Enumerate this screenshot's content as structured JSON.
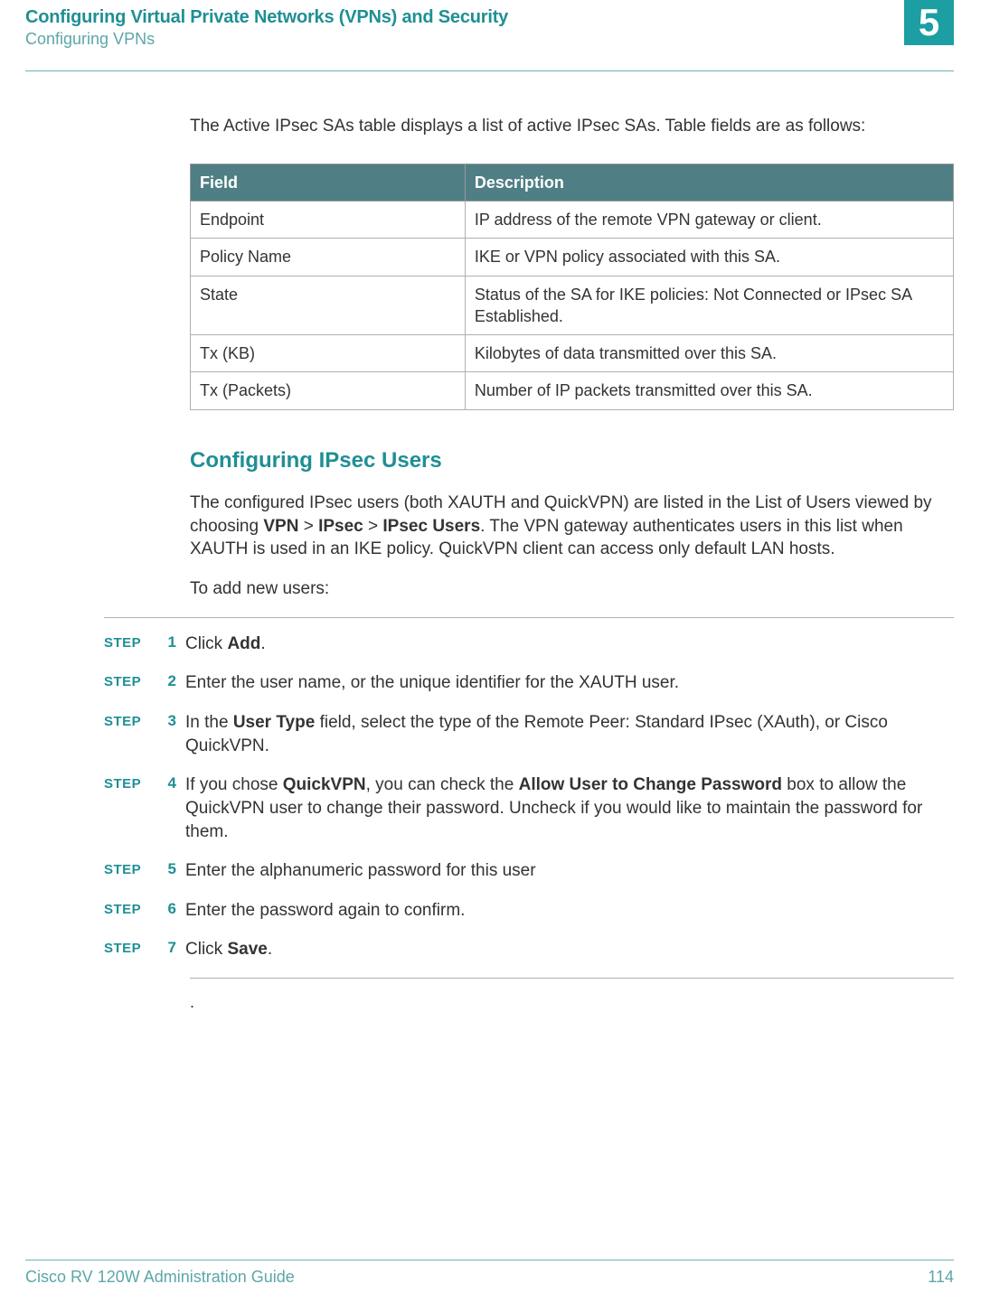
{
  "header": {
    "chapter_title": "Configuring Virtual Private Networks (VPNs) and Security",
    "section_title": "Configuring VPNs",
    "chapter_number": "5"
  },
  "intro_text": "The Active IPsec SAs table displays a list of active IPsec SAs. Table fields are as follows:",
  "table": {
    "col1_header": "Field",
    "col2_header": "Description",
    "rows": [
      {
        "field": "Endpoint",
        "desc": "IP address of the remote VPN gateway or client."
      },
      {
        "field": "Policy Name",
        "desc": "IKE or VPN policy associated with this SA."
      },
      {
        "field": "State",
        "desc": "Status of the SA for IKE policies: Not Connected or IPsec SA Established."
      },
      {
        "field": "Tx (KB)",
        "desc": "Kilobytes of data transmitted over this SA."
      },
      {
        "field": "Tx (Packets)",
        "desc": "Number of IP packets transmitted over this SA."
      }
    ]
  },
  "section_heading": "Configuring IPsec Users",
  "section_para": {
    "pre": "The configured IPsec users (both XAUTH and QuickVPN) are listed in the List of Users viewed by choosing ",
    "b1": "VPN",
    "sep1": " > ",
    "b2": "IPsec",
    "sep2": " > ",
    "b3": "IPsec Users",
    "post": ". The VPN gateway authenticates users in this list when XAUTH is used in an IKE policy. QuickVPN client can access only default LAN hosts."
  },
  "to_add": "To add new users:",
  "step_label": "STEP",
  "steps": [
    {
      "n": "1",
      "pre": "Click ",
      "b1": "Add",
      "post": "."
    },
    {
      "n": "2",
      "pre": "Enter the user name, or the unique identifier for the XAUTH user."
    },
    {
      "n": "3",
      "pre": "In the ",
      "b1": "User Type",
      "post": " field, select the type of the Remote Peer: Standard IPsec (XAuth), or Cisco QuickVPN."
    },
    {
      "n": "4",
      "pre": "If you chose ",
      "b1": "QuickVPN",
      "mid": ", you can check the ",
      "b2": "Allow User to Change Password",
      "post": " box to allow the QuickVPN user to change their password. Uncheck if you would like to maintain the password for them."
    },
    {
      "n": "5",
      "pre": "Enter the alphanumeric password for this user"
    },
    {
      "n": "6",
      "pre": "Enter the password again to confirm."
    },
    {
      "n": "7",
      "pre": "Click ",
      "b1": "Save",
      "post": "."
    }
  ],
  "post_step_dot": ".",
  "footer": {
    "guide": "Cisco RV 120W Administration Guide",
    "page": "114"
  }
}
